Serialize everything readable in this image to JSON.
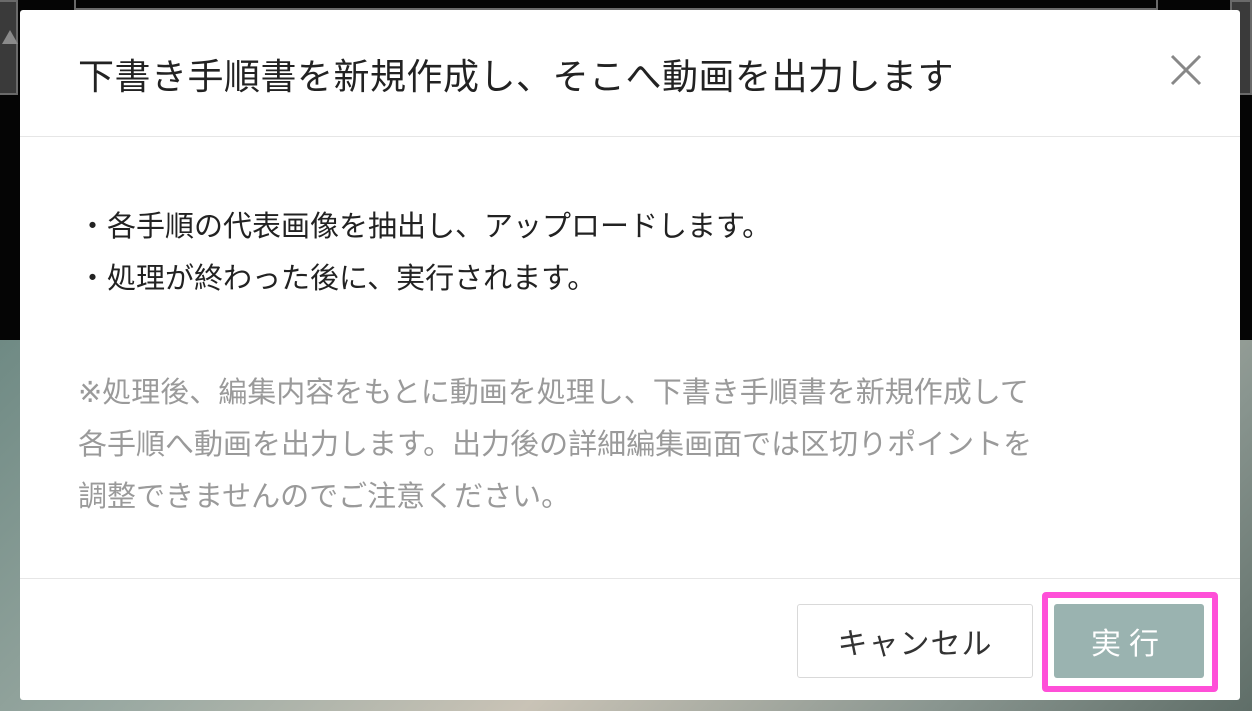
{
  "modal": {
    "title": "下書き手順書を新規作成し、そこへ動画を出力します",
    "close_icon": "close-icon",
    "bullets": [
      "・各手順の代表画像を抽出し、アップロードします。",
      "・処理が終わった後に、実行されます。"
    ],
    "note_lines": [
      "※処理後、編集内容をもとに動画を処理し、下書き手順書を新規作成して",
      "各手順へ動画を出力します。出力後の詳細編集画面では区切りポイントを",
      "調整できませんのでご注意ください。"
    ],
    "buttons": {
      "cancel_label": "キャンセル",
      "execute_label": "実行"
    }
  },
  "colors": {
    "execute_button": "#9ab3b0",
    "highlight_border": "#ff4fd8",
    "note_text": "#9a9a9a"
  }
}
